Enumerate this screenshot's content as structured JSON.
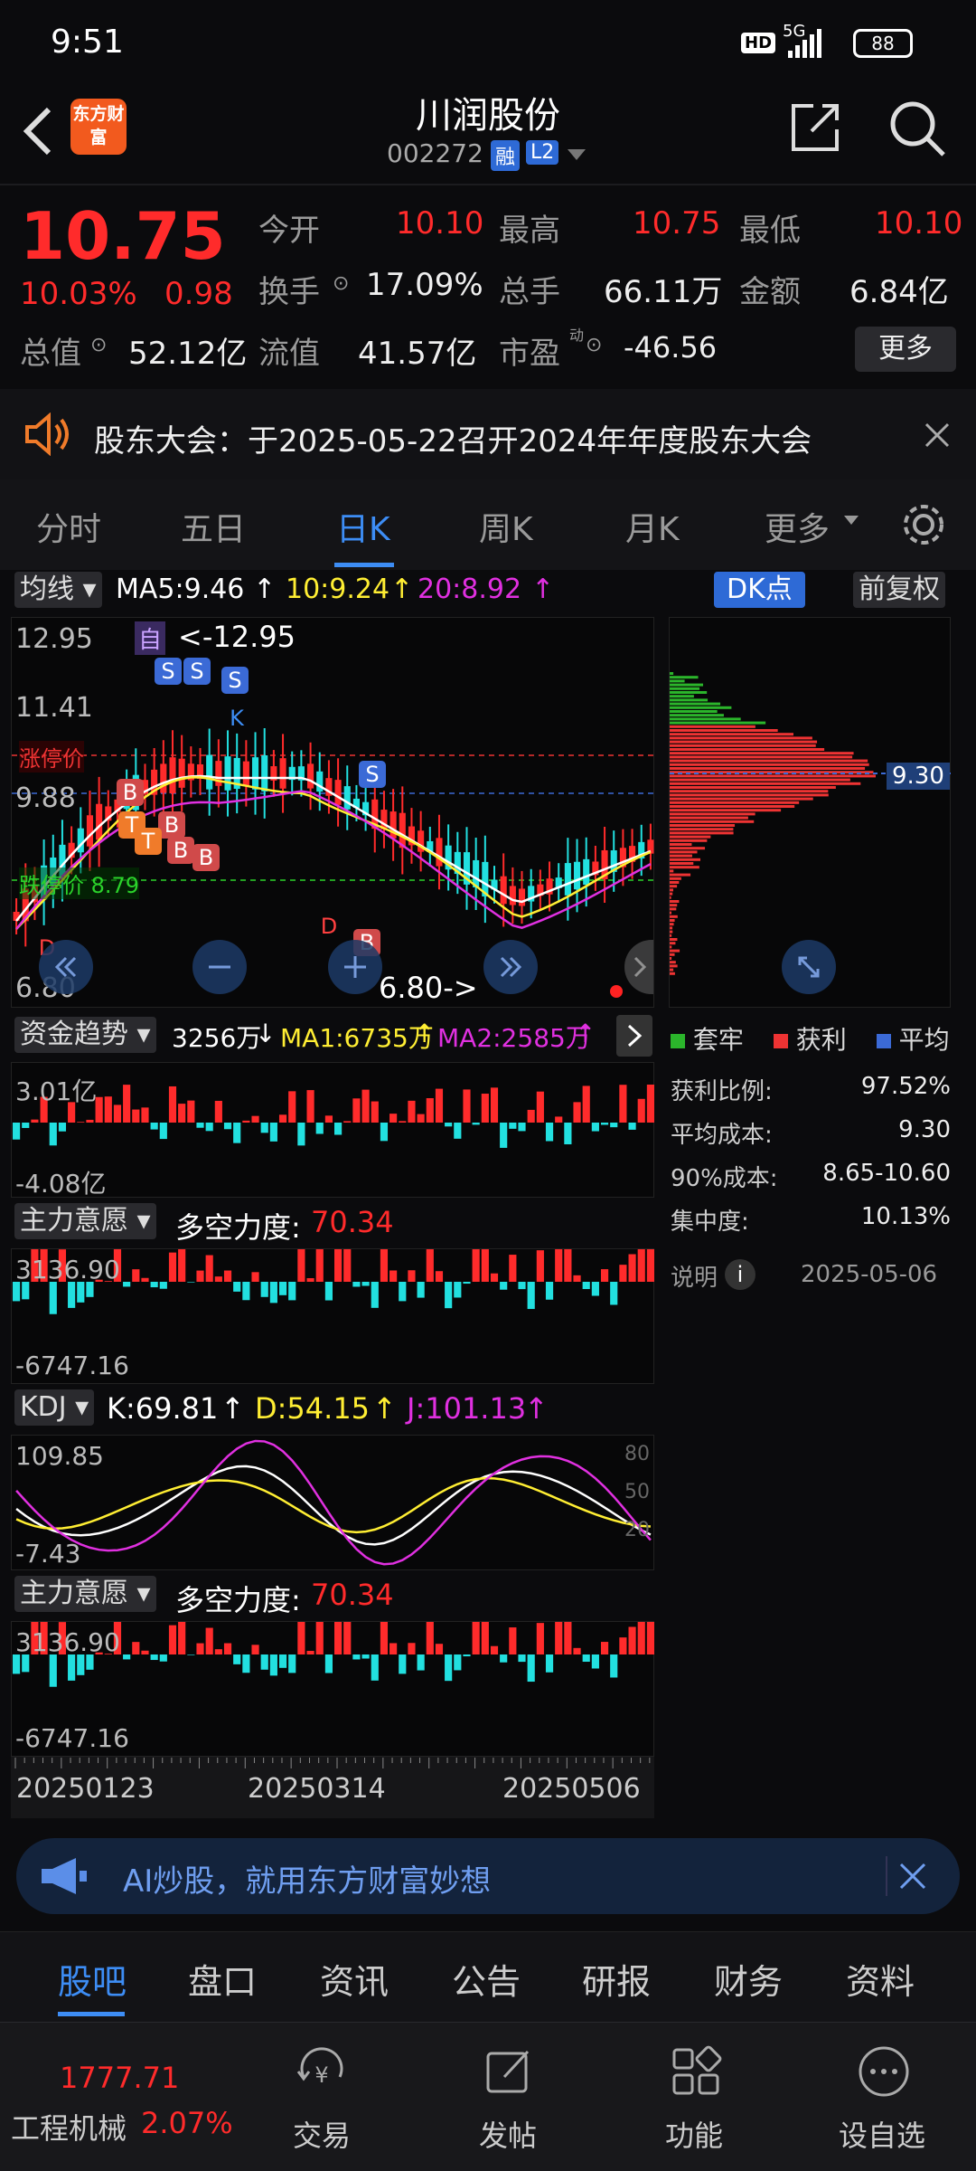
{
  "status": {
    "time": "9:51",
    "hd": "HD",
    "network": "5G",
    "battery": "88"
  },
  "header": {
    "logo": "东方财富",
    "title": "川润股份",
    "code": "002272",
    "badge_rong": "融",
    "badge_l2": "L2"
  },
  "quote": {
    "price": "10.75",
    "pct": "10.03%",
    "chg": "0.98",
    "open_label": "今开",
    "open": "10.10",
    "high_label": "最高",
    "high": "10.75",
    "low_label": "最低",
    "low": "10.10",
    "turnover_label": "换手",
    "turnover": "17.09%",
    "vol_label": "总手",
    "vol": "66.11万",
    "amount_label": "金额",
    "amount": "6.84亿",
    "mcap_label": "总值",
    "mcap": "52.12亿",
    "float_label": "流值",
    "float": "41.57亿",
    "pe_label": "市盈",
    "pe_sup": "动",
    "pe": "-46.56",
    "more": "更多"
  },
  "notice": {
    "text": "股东大会：于2025-05-22召开2024年年度股东大会"
  },
  "tabs": [
    "分时",
    "五日",
    "日K",
    "周K",
    "月K",
    "更多"
  ],
  "kline": {
    "ma_btn": "均线",
    "ma5": "MA5:9.46",
    "ma10": "10:9.24",
    "ma20": "20:8.92",
    "dk": "DK点",
    "fq": "前复权",
    "p_top": "12.95",
    "p2": "11.41",
    "p3": "9.88",
    "p_bottom": "6.80",
    "high_note": "<-12.95",
    "low_note": "6.80->",
    "zt": "涨停价",
    "dt": "跌停价 8.79",
    "zi": "自",
    "markers": [
      "S",
      "S",
      "S",
      "S",
      "B",
      "B",
      "B",
      "B",
      "T",
      "T",
      "B",
      "D",
      "D",
      "K"
    ]
  },
  "chip": {
    "avg_tag": "9.30",
    "legend": [
      "套牢",
      "获利",
      "平均"
    ],
    "rows": [
      {
        "k": "获利比例:",
        "v": "97.52%"
      },
      {
        "k": "平均成本:",
        "v": "9.30"
      },
      {
        "k": "90%成本:",
        "v": "8.65-10.60"
      },
      {
        "k": "集中度:",
        "v": "10.13%"
      }
    ],
    "note_label": "说明",
    "date": "2025-05-06"
  },
  "fund": {
    "btn": "资金趋势",
    "v": "3256万",
    "ma1": "MA1:6735万",
    "ma2": "MA2:2585万",
    "top": "3.01亿",
    "bottom": "-4.08亿"
  },
  "zl1": {
    "btn": "主力意愿",
    "label": "多空力度:",
    "val": "70.34",
    "top": "3136.90",
    "bottom": "-6747.16"
  },
  "kdj": {
    "btn": "KDJ",
    "k": "K:69.81",
    "d": "D:54.15",
    "j": "J:101.13",
    "top": "109.85",
    "bottom": "-7.43",
    "l80": "80",
    "l50": "50",
    "l20": "20"
  },
  "zl2": {
    "btn": "主力意愿",
    "label": "多空力度:",
    "val": "70.34",
    "top": "3136.90",
    "bottom": "-6747.16"
  },
  "dates": [
    "20250123",
    "20250314",
    "20250506"
  ],
  "banner": {
    "text": "AI炒股，就用东方财富妙想"
  },
  "bottom_tabs": [
    "股吧",
    "盘口",
    "资讯",
    "公告",
    "研报",
    "财务",
    "资料"
  ],
  "bottombar": {
    "index_val": "1777.71",
    "index_name": "工程机械",
    "index_pct": "2.07%",
    "items": [
      "交易",
      "发帖",
      "功能",
      "设自选"
    ]
  },
  "colors": {
    "up": "#ff2b2b",
    "down": "#22e0e0",
    "ma10": "#ffee33",
    "ma20": "#e030e0",
    "accent": "#3d8df5"
  }
}
